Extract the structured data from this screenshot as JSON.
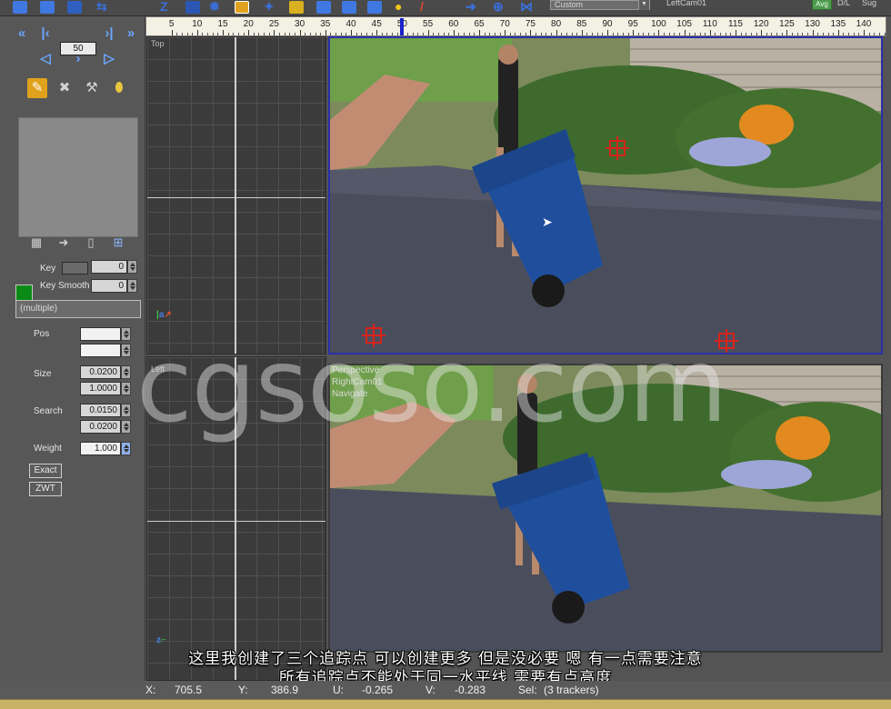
{
  "toolbar": {
    "view_select": "Custom",
    "camera_name": "LeftCam01",
    "avg_label": "Avg",
    "dl_label": "D/L",
    "sug_label": "Sug"
  },
  "timeline": {
    "ticks": [
      "5",
      "10",
      "15",
      "20",
      "25",
      "30",
      "35",
      "40",
      "45",
      "50",
      "55",
      "60",
      "65",
      "70",
      "75",
      "80",
      "85",
      "90",
      "95",
      "100",
      "105",
      "110",
      "115",
      "120",
      "125",
      "130",
      "135",
      "140"
    ],
    "current_frame": 50
  },
  "panel": {
    "frame_value": "50",
    "key_label": "Key",
    "key_value": "0",
    "key_smooth_label": "Key Smooth",
    "key_smooth_value": "0",
    "multiple_label": "(multiple)",
    "pos_label": "Pos",
    "size_label": "Size",
    "size_value_1": "0.0200",
    "size_value_2": "1.0000",
    "search_label": "Search",
    "search_value_1": "0.0150",
    "search_value_2": "0.0200",
    "weight_label": "Weight",
    "weight_value": "1.000",
    "exact_label": "Exact",
    "zwt_label": "ZWT"
  },
  "views": {
    "top_label": "Top",
    "left_label": "Left",
    "perspective_label": "Perspective",
    "camera_label": "RightCam01",
    "navigate_label": "Navigate"
  },
  "watermark": "cgsoso.com",
  "subtitles": {
    "line1": "这里我创建了三个追踪点 可以创建更多 但是没必要 嗯 有一点需要注意",
    "line2": "所有追踪点不能处于同一水平线 需要有点高度"
  },
  "status": {
    "x_label": "X:",
    "x_value": "705.5",
    "y_label": "Y:",
    "y_value": "386.9",
    "u_label": "U:",
    "u_value": "-0.265",
    "v_label": "V:",
    "v_value": "-0.283",
    "sel_label": "Sel:",
    "sel_value": "(3 trackers)"
  },
  "colors": {
    "accent_blue": "#3a6fd8",
    "tracker_red": "#d8231c",
    "key_color": "#0b8a16",
    "playhead": "#1a22c8"
  }
}
